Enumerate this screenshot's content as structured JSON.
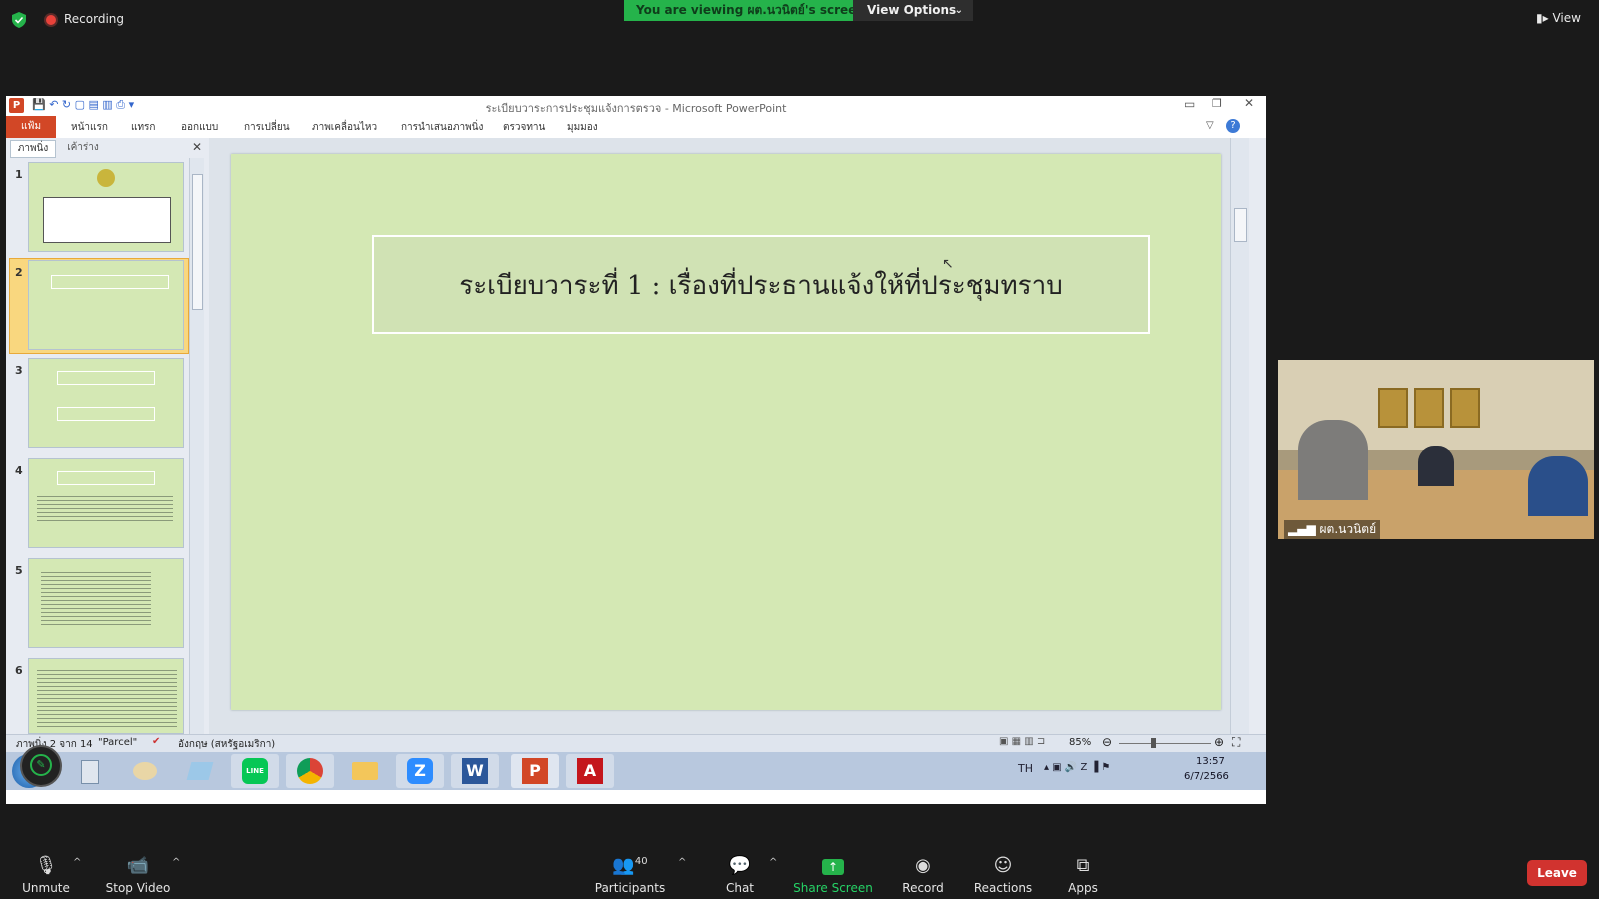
{
  "top_bar": {
    "recording": "Recording",
    "viewing_prefix": "You are viewing ",
    "viewing_name": "ผต.นวนิตย์",
    "viewing_suffix": "'s screen",
    "view_options": "View Options",
    "view": "View"
  },
  "ppt": {
    "window_title": "ระเบียบวาระการประชุมแจ้งการตรวจ - Microsoft PowerPoint",
    "tabs": [
      "แฟ้ม",
      "หน้าแรก",
      "แทรก",
      "ออกแบบ",
      "การเปลี่ยน",
      "ภาพเคลื่อนไหว",
      "การนำเสนอภาพนิ่ง",
      "ตรวจทาน",
      "มุมมอง"
    ],
    "panel_tabs": [
      "ภาพนิ่ง",
      "เค้าร่าง"
    ],
    "thumb_numbers": [
      "1",
      "2",
      "3",
      "4",
      "5",
      "6"
    ],
    "slide_title": "ระเบียบวาระที่  1 : เรื่องที่ประธานแจ้งให้ที่ประชุมทราบ",
    "status_slide": "ภาพนิ่ง 2 จาก 14",
    "status_theme": "\"Parcel\"",
    "status_language": "อังกฤษ (สหรัฐอเมริกา)",
    "zoom": "85%"
  },
  "taskbar": {
    "lang": "TH",
    "time": "13:57",
    "date": "6/7/2566"
  },
  "video": {
    "name": "ผต.นวนิตย์"
  },
  "toolbar": {
    "unmute": "Unmute",
    "stop_video": "Stop Video",
    "participants": "Participants",
    "participants_count": "40",
    "chat": "Chat",
    "share_screen": "Share Screen",
    "record": "Record",
    "reactions": "Reactions",
    "apps": "Apps",
    "leave": "Leave"
  },
  "colors": {
    "banner_green": "#25b34b",
    "slide_bg": "#d4e8b4",
    "leave_red": "#d1332f",
    "ppt_file_tab": "#d24726"
  }
}
